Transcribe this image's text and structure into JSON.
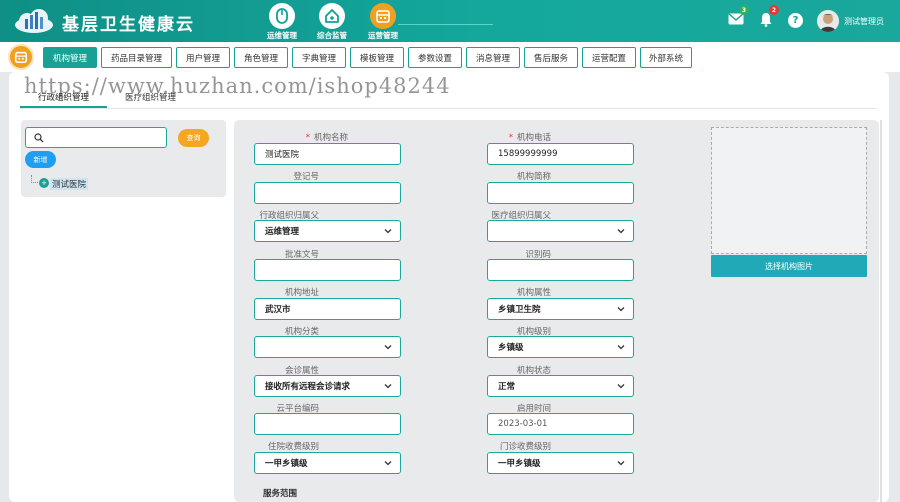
{
  "app": {
    "title": "基层卫生健康云"
  },
  "modules": [
    {
      "label": "运维管理",
      "icon": "mouse-icon"
    },
    {
      "label": "综合监管",
      "icon": "home-icon"
    },
    {
      "label": "运营管理",
      "icon": "calendar-icon"
    }
  ],
  "header": {
    "mail_count": "3",
    "notify_count": "2",
    "help": "?",
    "user_name": "测试管理员"
  },
  "nav": {
    "items": [
      "机构管理",
      "药品目录管理",
      "用户管理",
      "角色管理",
      "字典管理",
      "模板管理",
      "参数设置",
      "消息管理",
      "售后服务",
      "运营配置",
      "外部系统"
    ]
  },
  "tabs": {
    "t1": "行政组织管理",
    "t2": "医疗组织管理"
  },
  "tree": {
    "search_placeholder": "",
    "search_btn": "查询",
    "add_btn": "新增",
    "root_label": "测试医院"
  },
  "form": {
    "org_name_label": "机构名称",
    "org_name": "测试医院",
    "org_phone_label": "机构电话",
    "org_phone": "15899999999",
    "reg_no_label": "登记号",
    "reg_no": "",
    "short_name_label": "机构简称",
    "short_name": "",
    "admin_parent_label": "行政组织归属父",
    "admin_parent": "运维管理",
    "med_parent_label": "医疗组织归属父",
    "med_parent": "",
    "approval_label": "批准文号",
    "approval": "",
    "code_label": "识别码",
    "code": "",
    "address_label": "机构地址",
    "address": "武汉市",
    "attr_label": "机构属性",
    "attr": "乡镇卫生院",
    "category_label": "机构分类",
    "category": "",
    "level_label": "机构级别",
    "level": "乡镇级",
    "consult_label": "会诊属性",
    "consult": "接收所有远程会诊请求",
    "status_label": "机构状态",
    "status": "正常",
    "cloud_code_label": "云平台编码",
    "cloud_code": "",
    "enable_time_label": "启用时间",
    "enable_time": "2023-03-01",
    "inpatient_fee_label": "住院收费级别",
    "inpatient_fee": "一甲乡镇级",
    "outpatient_fee_label": "门诊收费级别",
    "outpatient_fee": "一甲乡镇级",
    "image_btn": "选择机构图片",
    "service_scope": "服务范围"
  },
  "watermark": "https://www.huzhan.com/ishop48244",
  "colors": {
    "primary": "#17a295",
    "accent": "#f0a020",
    "blue": "#1e9ff2",
    "danger": "#e53935"
  }
}
